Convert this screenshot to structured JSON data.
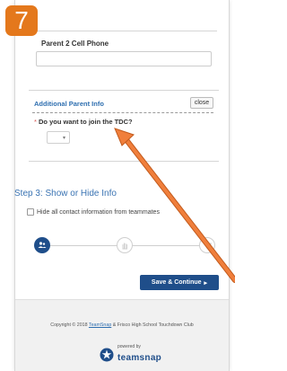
{
  "badge": "7",
  "parent2": {
    "label": "Parent 2 Cell Phone",
    "value": ""
  },
  "additional": {
    "title": "Additional Parent Info",
    "close_label": "close",
    "question": "Do you want to join the TDC?",
    "required_mark": "*",
    "select_value": ""
  },
  "step3": {
    "title": "Step 3: Show or Hide Info",
    "checkbox_label": "Hide all contact information from teammates"
  },
  "progress_steps": [
    "users-icon",
    "hand-icon",
    "cart-icon"
  ],
  "save_button": {
    "label": "Save & Continue",
    "arrow": "▸"
  },
  "footer": {
    "copyright_pre": "Copyright © 2018 ",
    "teamsnap_link": "TeamSnap",
    "copyright_post": " & Frisco High School Touchdown Club",
    "powered_by": "powered by",
    "brand": "teamsnap"
  },
  "colors": {
    "accent": "#1f4e8a",
    "link": "#2f6fb0",
    "badge": "#e4781c",
    "annotation": "#f07f3c"
  }
}
